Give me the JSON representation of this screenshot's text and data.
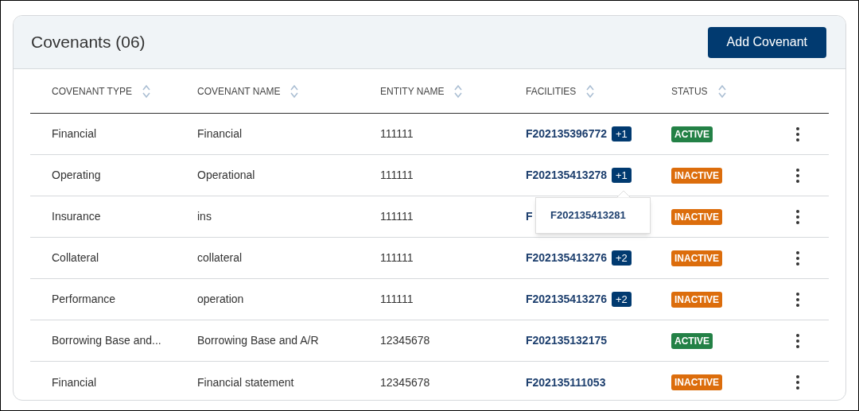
{
  "card": {
    "title": "Covenants (06)",
    "add_button": "Add Covenant"
  },
  "table": {
    "columns": [
      "COVENANT TYPE",
      "COVENANT NAME",
      "ENTITY NAME",
      "FACILITIES",
      "STATUS"
    ],
    "rows": [
      {
        "type": "Financial",
        "name": "Financial",
        "entity": "111111",
        "facility": "F202135396772",
        "extra": "+1",
        "status": {
          "label": "ACTIVE",
          "kind": "active"
        }
      },
      {
        "type": "Operating",
        "name": "Operational",
        "entity": "111111",
        "facility": "F202135413278",
        "extra": "+1",
        "status": {
          "label": "INACTIVE",
          "kind": "inactive"
        },
        "popover": {
          "items": [
            "F202135413281"
          ]
        }
      },
      {
        "type": "Insurance",
        "name": "ins",
        "entity": "111111",
        "facility": "F",
        "status": {
          "label": "INACTIVE",
          "kind": "inactive"
        }
      },
      {
        "type": "Collateral",
        "name": "collateral",
        "entity": "111111",
        "facility": "F202135413276",
        "extra": "+2",
        "status": {
          "label": "INACTIVE",
          "kind": "inactive"
        }
      },
      {
        "type": "Performance",
        "name": "operation",
        "entity": "111111",
        "facility": "F202135413276",
        "extra": "+2",
        "status": {
          "label": "INACTIVE",
          "kind": "inactive"
        }
      },
      {
        "type": "Borrowing Base and...",
        "name": "Borrowing Base and A/R",
        "entity": "12345678",
        "facility": "F202135132175",
        "status": {
          "label": "ACTIVE",
          "kind": "active"
        }
      },
      {
        "type": "Financial",
        "name": "Financial statement",
        "entity": "12345678",
        "facility": "F202135111053",
        "status": {
          "label": "INACTIVE",
          "kind": "inactive"
        }
      }
    ]
  }
}
